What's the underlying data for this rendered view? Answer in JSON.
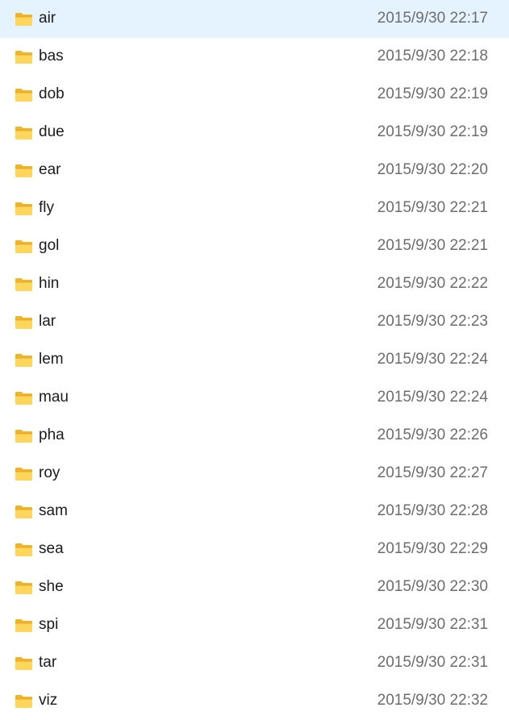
{
  "icon": "folder-icon",
  "colors": {
    "folder_front": "#ffd65c",
    "folder_back": "#f0b429",
    "name_text": "#1b1b1b",
    "date_text": "#6d6d6d"
  },
  "files": [
    {
      "name": "air",
      "modified": "2015/9/30 22:17"
    },
    {
      "name": "bas",
      "modified": "2015/9/30 22:18"
    },
    {
      "name": "dob",
      "modified": "2015/9/30 22:19"
    },
    {
      "name": "due",
      "modified": "2015/9/30 22:19"
    },
    {
      "name": "ear",
      "modified": "2015/9/30 22:20"
    },
    {
      "name": "fly",
      "modified": "2015/9/30 22:21"
    },
    {
      "name": "gol",
      "modified": "2015/9/30 22:21"
    },
    {
      "name": "hin",
      "modified": "2015/9/30 22:22"
    },
    {
      "name": "lar",
      "modified": "2015/9/30 22:23"
    },
    {
      "name": "lem",
      "modified": "2015/9/30 22:24"
    },
    {
      "name": "mau",
      "modified": "2015/9/30 22:24"
    },
    {
      "name": "pha",
      "modified": "2015/9/30 22:26"
    },
    {
      "name": "roy",
      "modified": "2015/9/30 22:27"
    },
    {
      "name": "sam",
      "modified": "2015/9/30 22:28"
    },
    {
      "name": "sea",
      "modified": "2015/9/30 22:29"
    },
    {
      "name": "she",
      "modified": "2015/9/30 22:30"
    },
    {
      "name": "spi",
      "modified": "2015/9/30 22:31"
    },
    {
      "name": "tar",
      "modified": "2015/9/30 22:31"
    },
    {
      "name": "viz",
      "modified": "2015/9/30 22:32"
    }
  ]
}
